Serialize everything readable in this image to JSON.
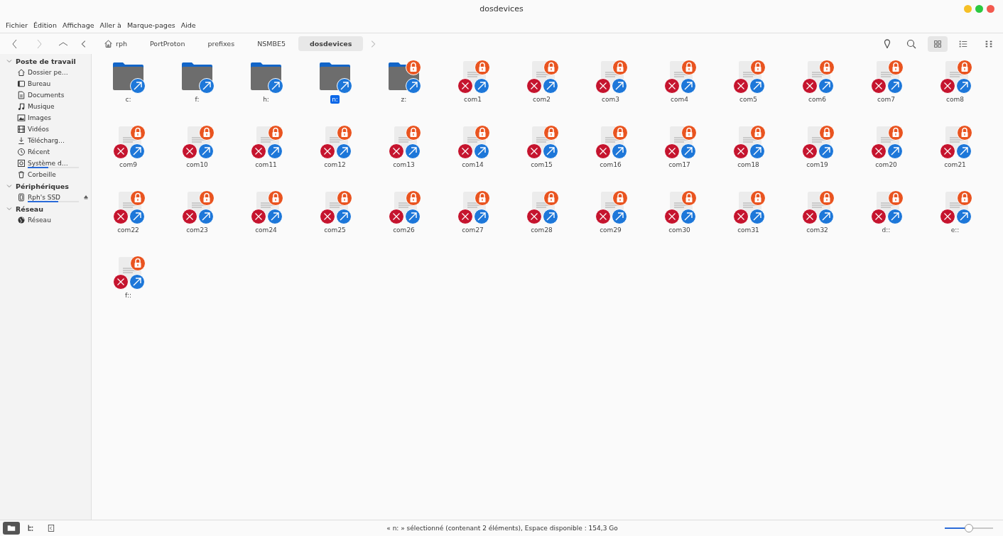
{
  "window": {
    "title": "dosdevices"
  },
  "menu": [
    "Fichier",
    "Édition",
    "Affichage",
    "Aller à",
    "Marque-pages",
    "Aide"
  ],
  "breadcrumbs": [
    {
      "label": "rph",
      "kind": "home",
      "selected": false
    },
    {
      "label": "PortProton",
      "kind": "dir",
      "selected": false
    },
    {
      "label": "prefixes",
      "kind": "dir",
      "selected": false
    },
    {
      "label": "NSMBE5",
      "kind": "dir",
      "selected": false
    },
    {
      "label": "dosdevices",
      "kind": "dir",
      "selected": true
    }
  ],
  "view_modes": [
    {
      "kind": "icons",
      "selected": true
    },
    {
      "kind": "details",
      "selected": false
    },
    {
      "kind": "compact",
      "selected": false
    }
  ],
  "sidebar": [
    {
      "label": "Poste de travail",
      "expanded": true,
      "items": [
        {
          "label": "Dossier pe…",
          "kind": "home"
        },
        {
          "label": "Bureau",
          "kind": "desktop"
        },
        {
          "label": "Documents",
          "kind": "document"
        },
        {
          "label": "Musique",
          "kind": "music"
        },
        {
          "label": "Images",
          "kind": "image"
        },
        {
          "label": "Vidéos",
          "kind": "film"
        },
        {
          "label": "Télécharg…",
          "kind": "download"
        },
        {
          "label": "Récent",
          "kind": "clock"
        },
        {
          "label": "Système d…",
          "kind": "disk",
          "level": 0.4
        },
        {
          "label": "Corbeille",
          "kind": "trash"
        }
      ]
    },
    {
      "label": "Périphériques",
      "expanded": true,
      "items": [
        {
          "label": "Rph's SSD",
          "kind": "drive",
          "level": 0.6,
          "eject": true
        }
      ]
    },
    {
      "label": "Réseau",
      "expanded": true,
      "items": [
        {
          "label": "Réseau",
          "kind": "globe"
        }
      ]
    }
  ],
  "files": [
    {
      "name": "c:",
      "kind": "folder",
      "locked": false,
      "selected": false
    },
    {
      "name": "f:",
      "kind": "folder",
      "locked": false,
      "selected": false
    },
    {
      "name": "h:",
      "kind": "folder",
      "locked": false,
      "selected": false
    },
    {
      "name": "n:",
      "kind": "folder",
      "locked": false,
      "selected": true
    },
    {
      "name": "z:",
      "kind": "folder",
      "locked": true,
      "selected": false
    },
    {
      "name": "com1",
      "kind": "broken",
      "locked": true,
      "selected": false
    },
    {
      "name": "com2",
      "kind": "broken",
      "locked": true,
      "selected": false
    },
    {
      "name": "com3",
      "kind": "broken",
      "locked": true,
      "selected": false
    },
    {
      "name": "com4",
      "kind": "broken",
      "locked": true,
      "selected": false
    },
    {
      "name": "com5",
      "kind": "broken",
      "locked": true,
      "selected": false
    },
    {
      "name": "com6",
      "kind": "broken",
      "locked": true,
      "selected": false
    },
    {
      "name": "com7",
      "kind": "broken",
      "locked": true,
      "selected": false
    },
    {
      "name": "com8",
      "kind": "broken",
      "locked": true,
      "selected": false
    },
    {
      "name": "com9",
      "kind": "broken",
      "locked": true,
      "selected": false
    },
    {
      "name": "com10",
      "kind": "broken",
      "locked": true,
      "selected": false
    },
    {
      "name": "com11",
      "kind": "broken",
      "locked": true,
      "selected": false
    },
    {
      "name": "com12",
      "kind": "broken",
      "locked": true,
      "selected": false
    },
    {
      "name": "com13",
      "kind": "broken",
      "locked": true,
      "selected": false
    },
    {
      "name": "com14",
      "kind": "broken",
      "locked": true,
      "selected": false
    },
    {
      "name": "com15",
      "kind": "broken",
      "locked": true,
      "selected": false
    },
    {
      "name": "com16",
      "kind": "broken",
      "locked": true,
      "selected": false
    },
    {
      "name": "com17",
      "kind": "broken",
      "locked": true,
      "selected": false
    },
    {
      "name": "com18",
      "kind": "broken",
      "locked": true,
      "selected": false
    },
    {
      "name": "com19",
      "kind": "broken",
      "locked": true,
      "selected": false
    },
    {
      "name": "com20",
      "kind": "broken",
      "locked": true,
      "selected": false
    },
    {
      "name": "com21",
      "kind": "broken",
      "locked": true,
      "selected": false
    },
    {
      "name": "com22",
      "kind": "broken",
      "locked": true,
      "selected": false
    },
    {
      "name": "com23",
      "kind": "broken",
      "locked": true,
      "selected": false
    },
    {
      "name": "com24",
      "kind": "broken",
      "locked": true,
      "selected": false
    },
    {
      "name": "com25",
      "kind": "broken",
      "locked": true,
      "selected": false
    },
    {
      "name": "com26",
      "kind": "broken",
      "locked": true,
      "selected": false
    },
    {
      "name": "com27",
      "kind": "broken",
      "locked": true,
      "selected": false
    },
    {
      "name": "com28",
      "kind": "broken",
      "locked": true,
      "selected": false
    },
    {
      "name": "com29",
      "kind": "broken",
      "locked": true,
      "selected": false
    },
    {
      "name": "com30",
      "kind": "broken",
      "locked": true,
      "selected": false
    },
    {
      "name": "com31",
      "kind": "broken",
      "locked": true,
      "selected": false
    },
    {
      "name": "com32",
      "kind": "broken",
      "locked": true,
      "selected": false
    },
    {
      "name": "d::",
      "kind": "broken",
      "locked": true,
      "selected": false
    },
    {
      "name": "e::",
      "kind": "broken",
      "locked": true,
      "selected": false
    },
    {
      "name": "f::",
      "kind": "broken",
      "locked": true,
      "selected": false
    }
  ],
  "status_bar": {
    "panel_modes": [
      {
        "kind": "places",
        "selected": true
      },
      {
        "kind": "tree",
        "selected": false
      },
      {
        "kind": "hide",
        "selected": false
      }
    ],
    "text": "« n: » sélectionné (contenant 2 éléments), Espace disponible : 154,3 Go",
    "zoom": {
      "level": 0.5
    }
  }
}
